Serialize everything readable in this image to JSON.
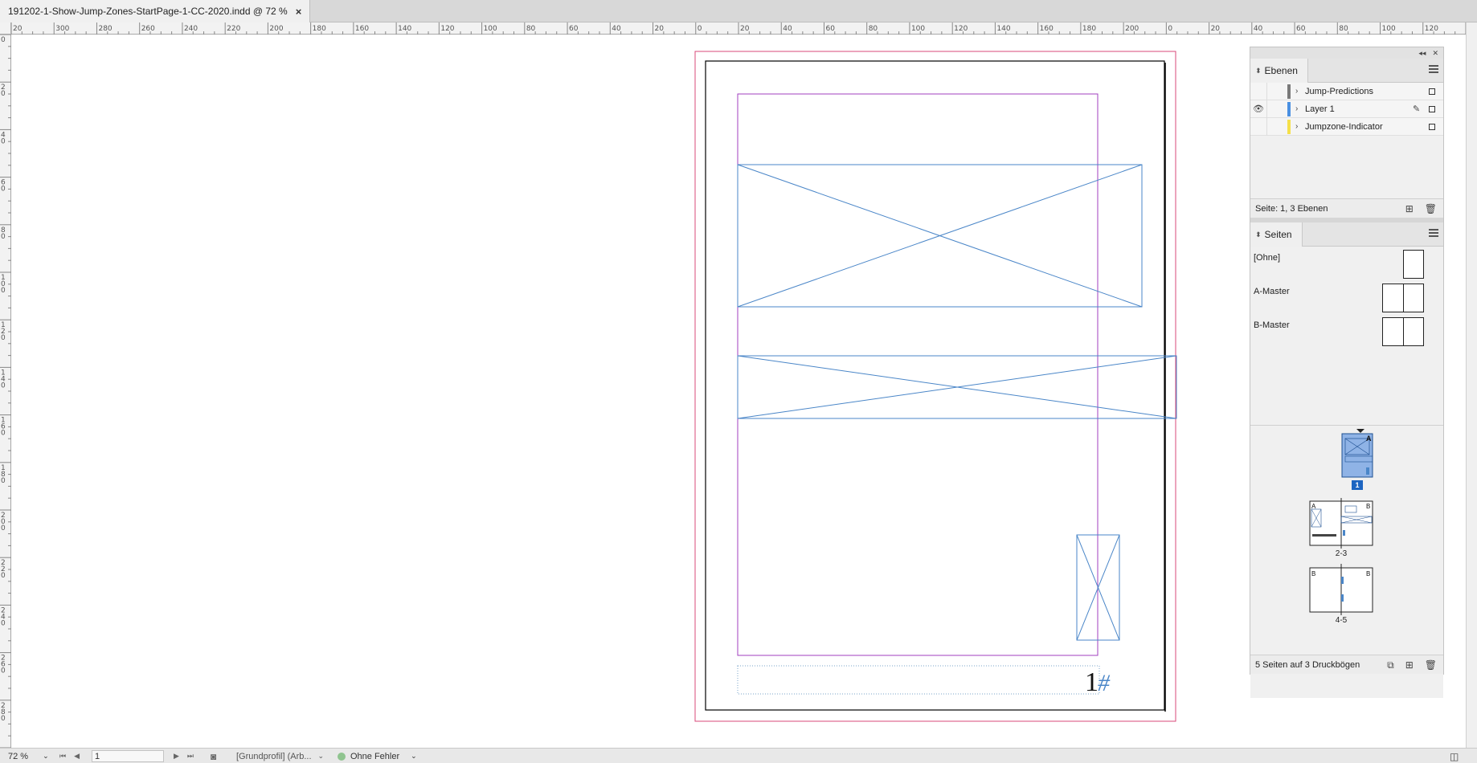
{
  "document": {
    "tab_title": "191202-1-Show-Jump-Zones-StartPage-1-CC-2020.indd @ 72 %",
    "close_glyph": "×"
  },
  "rulers": {
    "horizontal_labels": [
      "20",
      "300",
      "280",
      "260",
      "240",
      "220",
      "200",
      "180",
      "160",
      "140",
      "120",
      "100",
      "80",
      "60",
      "40",
      "20",
      "0",
      "20",
      "40",
      "60",
      "80",
      "100",
      "120",
      "140",
      "160",
      "180",
      "200",
      "0",
      "20",
      "40",
      "60",
      "80",
      "100",
      "120"
    ],
    "vertical_labels": [
      "0",
      "2 0",
      "4 0",
      "6 0",
      "8 0",
      "1 0 0",
      "1 2 0",
      "1 4 0",
      "1 6 0",
      "1 8 0",
      "2 0 0",
      "2 2 0",
      "2 4 0",
      "2 6 0",
      "2 8 0"
    ]
  },
  "canvas": {
    "page_number_marker": "1",
    "page_number_hash": "#"
  },
  "panel_dock": {
    "collapse_glyph": "◂◂",
    "close_glyph": "✕"
  },
  "layers_panel": {
    "title": "Ebenen",
    "layers": [
      {
        "name": "Jump-Predictions",
        "color": "#7a7a7a",
        "visible": false,
        "pen": false
      },
      {
        "name": "Layer 1",
        "color": "#4a90e2",
        "visible": true,
        "pen": true
      },
      {
        "name": "Jumpzone-Indicator",
        "color": "#f5e04a",
        "visible": false,
        "pen": false
      }
    ],
    "footer_text": "Seite: 1, 3 Ebenen"
  },
  "pages_panel": {
    "title": "Seiten",
    "masters": [
      {
        "label": "[Ohne]",
        "kind": "single"
      },
      {
        "label": "A-Master",
        "kind": "spread"
      },
      {
        "label": "B-Master",
        "kind": "spread"
      }
    ],
    "page_labels": [
      "1",
      "2-3",
      "4-5"
    ],
    "thumb_letters": {
      "page1": "A",
      "spread2_left": "A",
      "spread2_right": "B",
      "spread3_left": "B",
      "spread3_right": "B"
    },
    "footer_text": "5 Seiten auf 3 Druckbögen"
  },
  "statusbar": {
    "zoom": "72 %",
    "page": "1",
    "profile": "[Grundprofil] (Arb...",
    "preflight": "Ohne Fehler"
  },
  "colors": {
    "page_border": "#000000",
    "bleed": "#d9487a",
    "margin": "#a13fbf",
    "frame": "#4a86c8"
  }
}
